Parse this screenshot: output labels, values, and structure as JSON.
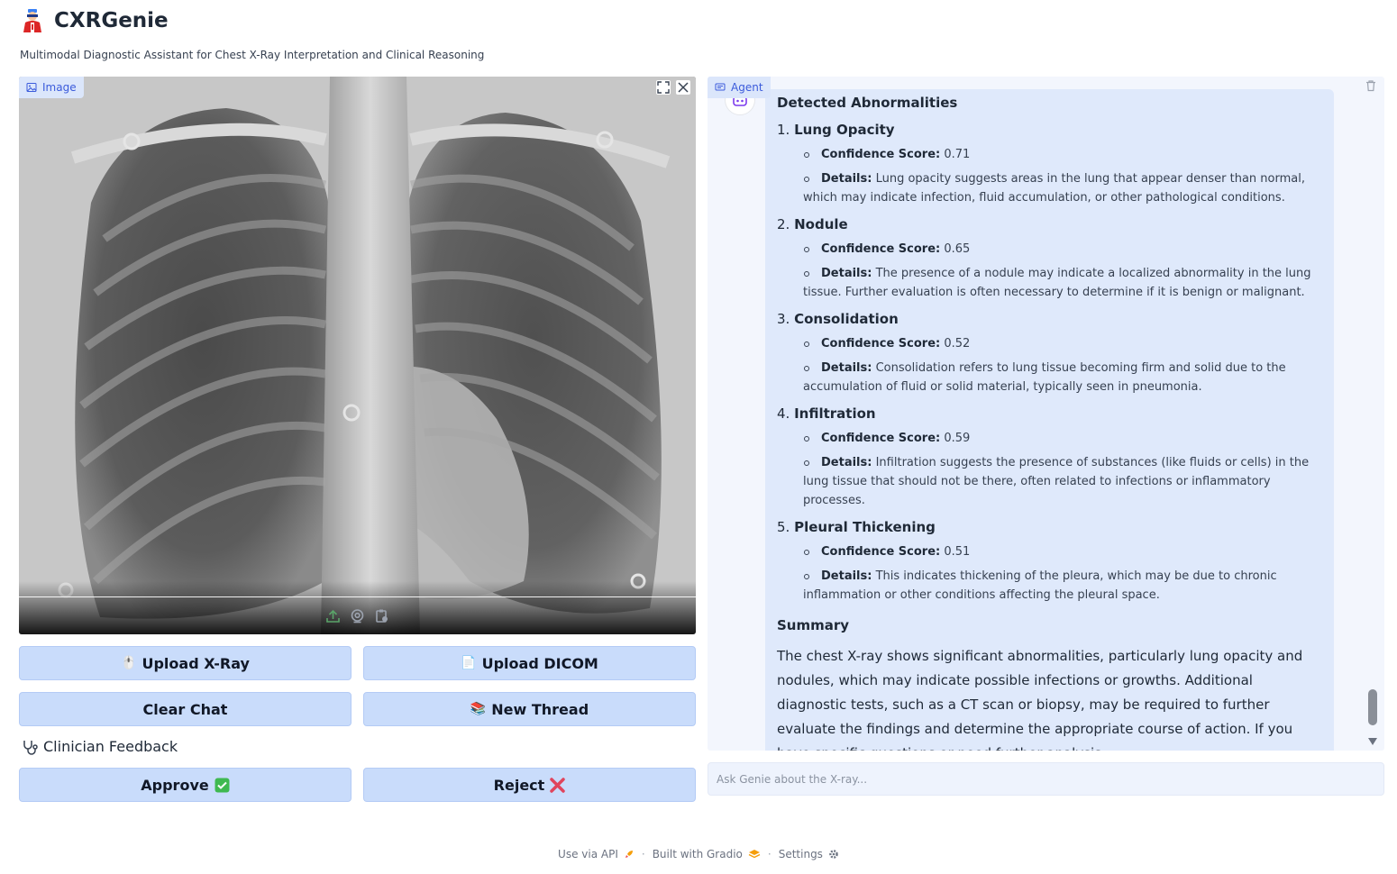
{
  "header": {
    "title": "CXRGenie",
    "subtitle": "Multimodal Diagnostic Assistant for Chest X-Ray Interpretation and Clinical Reasoning"
  },
  "image_panel": {
    "label": "Image",
    "tools": [
      "fullscreen-icon",
      "close-icon"
    ],
    "bottom_tools": [
      "upload-icon",
      "webcam-icon",
      "clipboard-icon"
    ]
  },
  "buttons": {
    "upload_xray": "Upload X-Ray",
    "upload_dicom": "Upload DICOM",
    "clear_chat": "Clear Chat",
    "new_thread": "New Thread",
    "approve": "Approve",
    "reject": "Reject"
  },
  "feedback": {
    "label": "Clinician Feedback"
  },
  "chat": {
    "label": "Agent",
    "heading": "Detected Abnormalities",
    "findings": [
      {
        "num": "1.",
        "name": "Lung Opacity",
        "score_key": "Confidence Score:",
        "score": "0.71",
        "details_key": "Details:",
        "details": "Lung opacity suggests areas in the lung that appear denser than normal, which may indicate infection, fluid accumulation, or other pathological conditions."
      },
      {
        "num": "2.",
        "name": "Nodule",
        "score_key": "Confidence Score:",
        "score": "0.65",
        "details_key": "Details:",
        "details": "The presence of a nodule may indicate a localized abnormality in the lung tissue. Further evaluation is often necessary to determine if it is benign or malignant."
      },
      {
        "num": "3.",
        "name": "Consolidation",
        "score_key": "Confidence Score:",
        "score": "0.52",
        "details_key": "Details:",
        "details": "Consolidation refers to lung tissue becoming firm and solid due to the accumulation of fluid or solid material, typically seen in pneumonia."
      },
      {
        "num": "4.",
        "name": "Infiltration",
        "score_key": "Confidence Score:",
        "score": "0.59",
        "details_key": "Details:",
        "details": "Infiltration suggests the presence of substances (like fluids or cells) in the lung tissue that should not be there, often related to infections or inflammatory processes."
      },
      {
        "num": "5.",
        "name": "Pleural Thickening",
        "score_key": "Confidence Score:",
        "score": "0.51",
        "details_key": "Details:",
        "details": "This indicates thickening of the pleura, which may be due to chronic inflammation or other conditions affecting the pleural space."
      }
    ],
    "summary_title": "Summary",
    "summary_text": "The chest X-ray shows significant abnormalities, particularly lung opacity and nodules, which may indicate possible infections or growths. Additional diagnostic tests, such as a CT scan or biopsy, may be required to further evaluate the findings and determine the appropriate course of action. If you have specific questions or need further analysis,",
    "input_placeholder": "Ask Genie about the X-ray..."
  },
  "footer": {
    "api": "Use via API",
    "built": "Built with Gradio",
    "settings": "Settings",
    "separator": "·"
  },
  "colors": {
    "button_bg": "#c9dcfb",
    "chat_bg": "#f3f6fd",
    "message_bg": "#dfe9fb",
    "label_accent": "#3b5bdb"
  }
}
